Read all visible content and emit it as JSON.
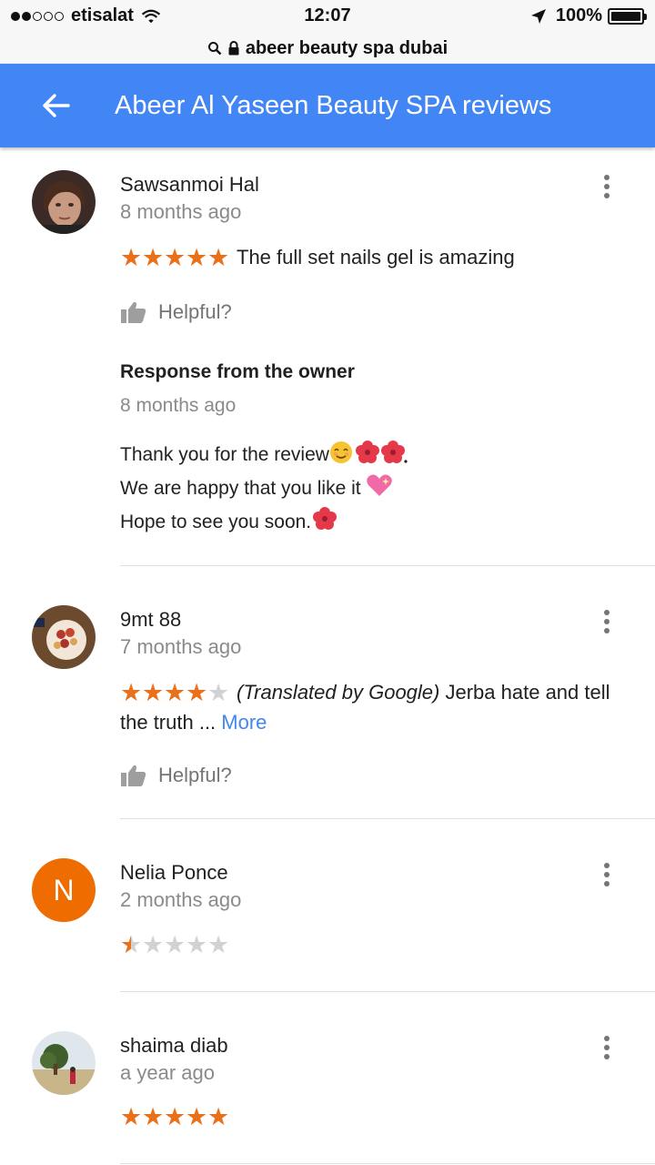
{
  "status_bar": {
    "carrier": "etisalat",
    "time": "12:07",
    "battery": "100%"
  },
  "url_bar": {
    "url": "abeer beauty spa dubai"
  },
  "header": {
    "title": "Abeer Al Yaseen Beauty SPA reviews"
  },
  "reviews": [
    {
      "name": "Sawsanmoi Hal",
      "date": "8 months ago",
      "rating": 5,
      "text": "The full set nails gel is amazing",
      "helpful_label": "Helpful?",
      "owner_response": {
        "title": "Response from the owner",
        "date": "8 months ago",
        "line1": "Thank you for the review",
        "line2": "We are happy that you like it",
        "line3": "Hope to see you soon."
      }
    },
    {
      "name": "9mt 88",
      "date": "7 months ago",
      "rating": 4,
      "translated_prefix": "(Translated by Google)",
      "text": " Jerba hate and tell the truth ... ",
      "more_label": "More",
      "helpful_label": "Helpful?"
    },
    {
      "name": "Nelia Ponce",
      "avatar_letter": "N",
      "date": "2 months ago",
      "rating": 1
    },
    {
      "name": "shaima diab",
      "date": "a year ago",
      "rating": 5
    }
  ],
  "colors": {
    "header": "#4285f4",
    "star": "#e8711a",
    "star_empty": "#d2d2d2",
    "avatar_n": "#ef6c00"
  },
  "icons": [
    "back-arrow-icon",
    "more-vert-icon",
    "thumb-up-icon",
    "lock-icon",
    "search-icon",
    "wifi-icon",
    "location-arrow-icon",
    "battery-icon"
  ]
}
